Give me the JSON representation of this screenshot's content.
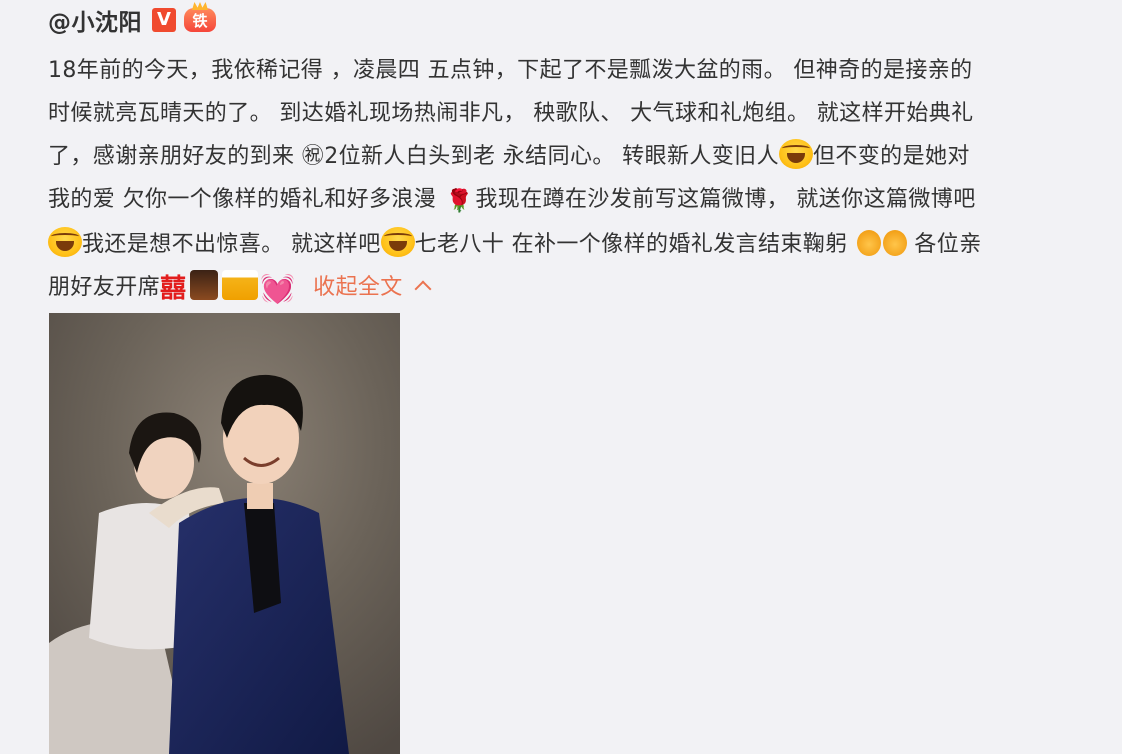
{
  "post": {
    "author": "@小沈阳",
    "vip_badge": "V",
    "fan_badge": "铁",
    "lines": [
      "18年前的今天，我依稀记得 ，凌晨四 五点钟，下起了不是瓢泼大盆的雨。 但神奇的是接亲的",
      "时候就亮瓦晴天的了。 到达婚礼现场热闹非凡， 秧歌队、 大气球和礼炮组。 就这样开始典礼",
      "了，感谢亲朋好友的到来 ㊗2位新人白头到老 永结同心。 转眼新人变旧人",
      "但不变的是她对",
      "我的爱 欠你一个像样的婚礼和好多浪漫",
      "我现在蹲在沙发前写这篇微博， 就送你这篇微博吧",
      "我还是想不出惊喜。 就这样吧",
      "七老八十 在补一个像样的婚礼发言结束鞠躬",
      " 各位亲",
      "朋好友开席"
    ],
    "rose": "🌹",
    "heart": "💓",
    "xi": "囍",
    "collapse_label": "收起全文"
  },
  "icons": {
    "laugh": "laugh-cry-emoji",
    "rose": "rose-emoji",
    "couple": "couple-emoji",
    "xi": "double-happiness-emoji",
    "drink": "drink-emoji",
    "beer": "beer-emoji",
    "heart": "heart-emoji",
    "chevron": "chevron-up-icon"
  },
  "colors": {
    "link": "#eb7350",
    "text": "#333333",
    "vip": "#f04a2e",
    "background": "#f2f2f5"
  }
}
